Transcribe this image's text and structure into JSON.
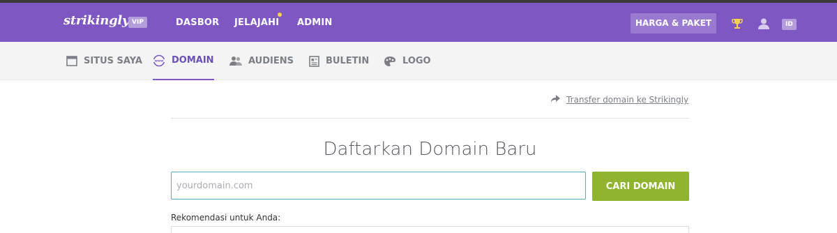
{
  "brand": {
    "logo": "strikingly",
    "badge": "VIP"
  },
  "top_nav": [
    {
      "label": "DASBOR"
    },
    {
      "label": "JELAJAHI"
    },
    {
      "label": "ADMIN"
    }
  ],
  "pricing_button": "HARGA & PAKET",
  "language": "ID",
  "sub_nav": [
    {
      "label": "SITUS SAYA",
      "icon": "browser-window-icon"
    },
    {
      "label": "DOMAIN",
      "icon": "www-globe-icon",
      "active": true
    },
    {
      "label": "AUDIENS",
      "icon": "people-icon"
    },
    {
      "label": "BULETIN",
      "icon": "newsletter-icon"
    },
    {
      "label": "LOGO",
      "icon": "palette-icon"
    }
  ],
  "transfer_link": "Transfer domain ke Strikingly",
  "page_heading": "Daftarkan Domain Baru",
  "search": {
    "placeholder": "yourdomain.com",
    "value": "",
    "button": "CARI DOMAIN"
  },
  "recommendations_label": "Rekomendasi untuk Anda:",
  "colors": {
    "header": "#7e57c2",
    "accent_green": "#8fb52e",
    "input_border": "#4fb3c8",
    "notification_dot": "#f6d24a"
  }
}
